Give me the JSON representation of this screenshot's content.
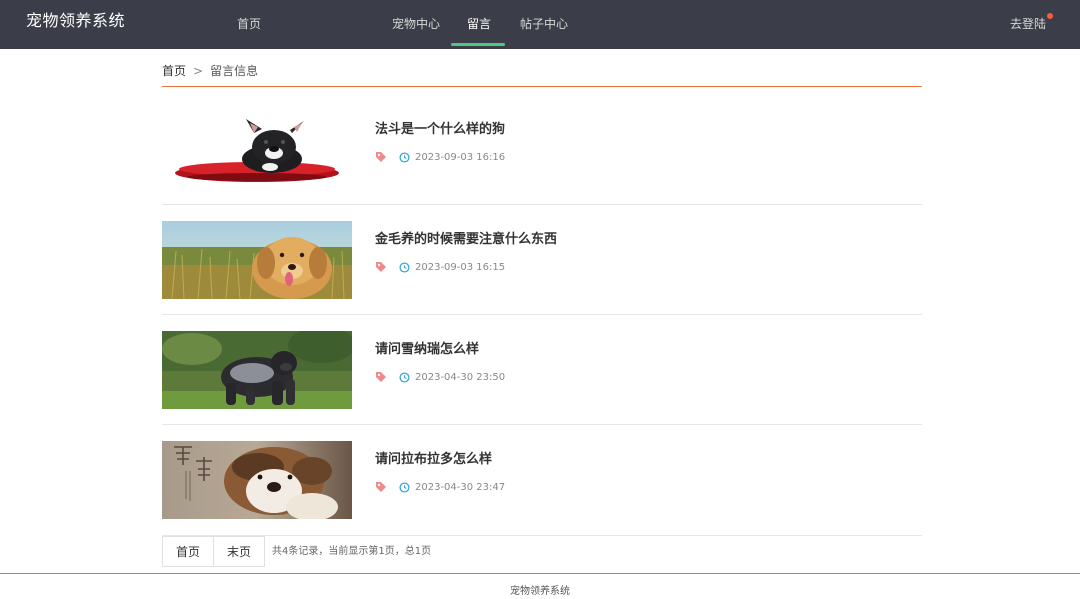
{
  "header": {
    "brand": "宠物领养系统",
    "nav": [
      "首页",
      "宠物中心",
      "留言",
      "帖子中心"
    ],
    "active_nav": "留言",
    "login": "去登陆"
  },
  "breadcrumb": {
    "home": "首页",
    "separator": ">",
    "current": "留言信息"
  },
  "posts": [
    {
      "title": "法斗是一个什么样的狗",
      "time": "2023-09-03 16:16",
      "image": "french-bulldog-on-red-cushion"
    },
    {
      "title": "金毛养的时候需要注意什么东西",
      "time": "2023-09-03 16:15",
      "image": "golden-retriever-puppy-in-grass"
    },
    {
      "title": "请问雪纳瑞怎么样",
      "time": "2023-04-30 23:50",
      "image": "gorilla-on-grass"
    },
    {
      "title": "请问拉布拉多怎么样",
      "time": "2023-04-30 23:47",
      "image": "puppy-with-calligraphy"
    }
  ],
  "pagination": {
    "first": "首页",
    "last": "末页",
    "info": "共4条记录，当前显示第1页，总1页"
  },
  "footer": "宠物领养系统",
  "colors": {
    "header_bg": "#3b3e48",
    "accent_orange": "#e8763a",
    "active_underline": "#4ccb7f",
    "tag_icon": "#f08a8a",
    "clock_icon": "#3aa7d8"
  },
  "icons": [
    "tag-icon",
    "clock-icon"
  ]
}
